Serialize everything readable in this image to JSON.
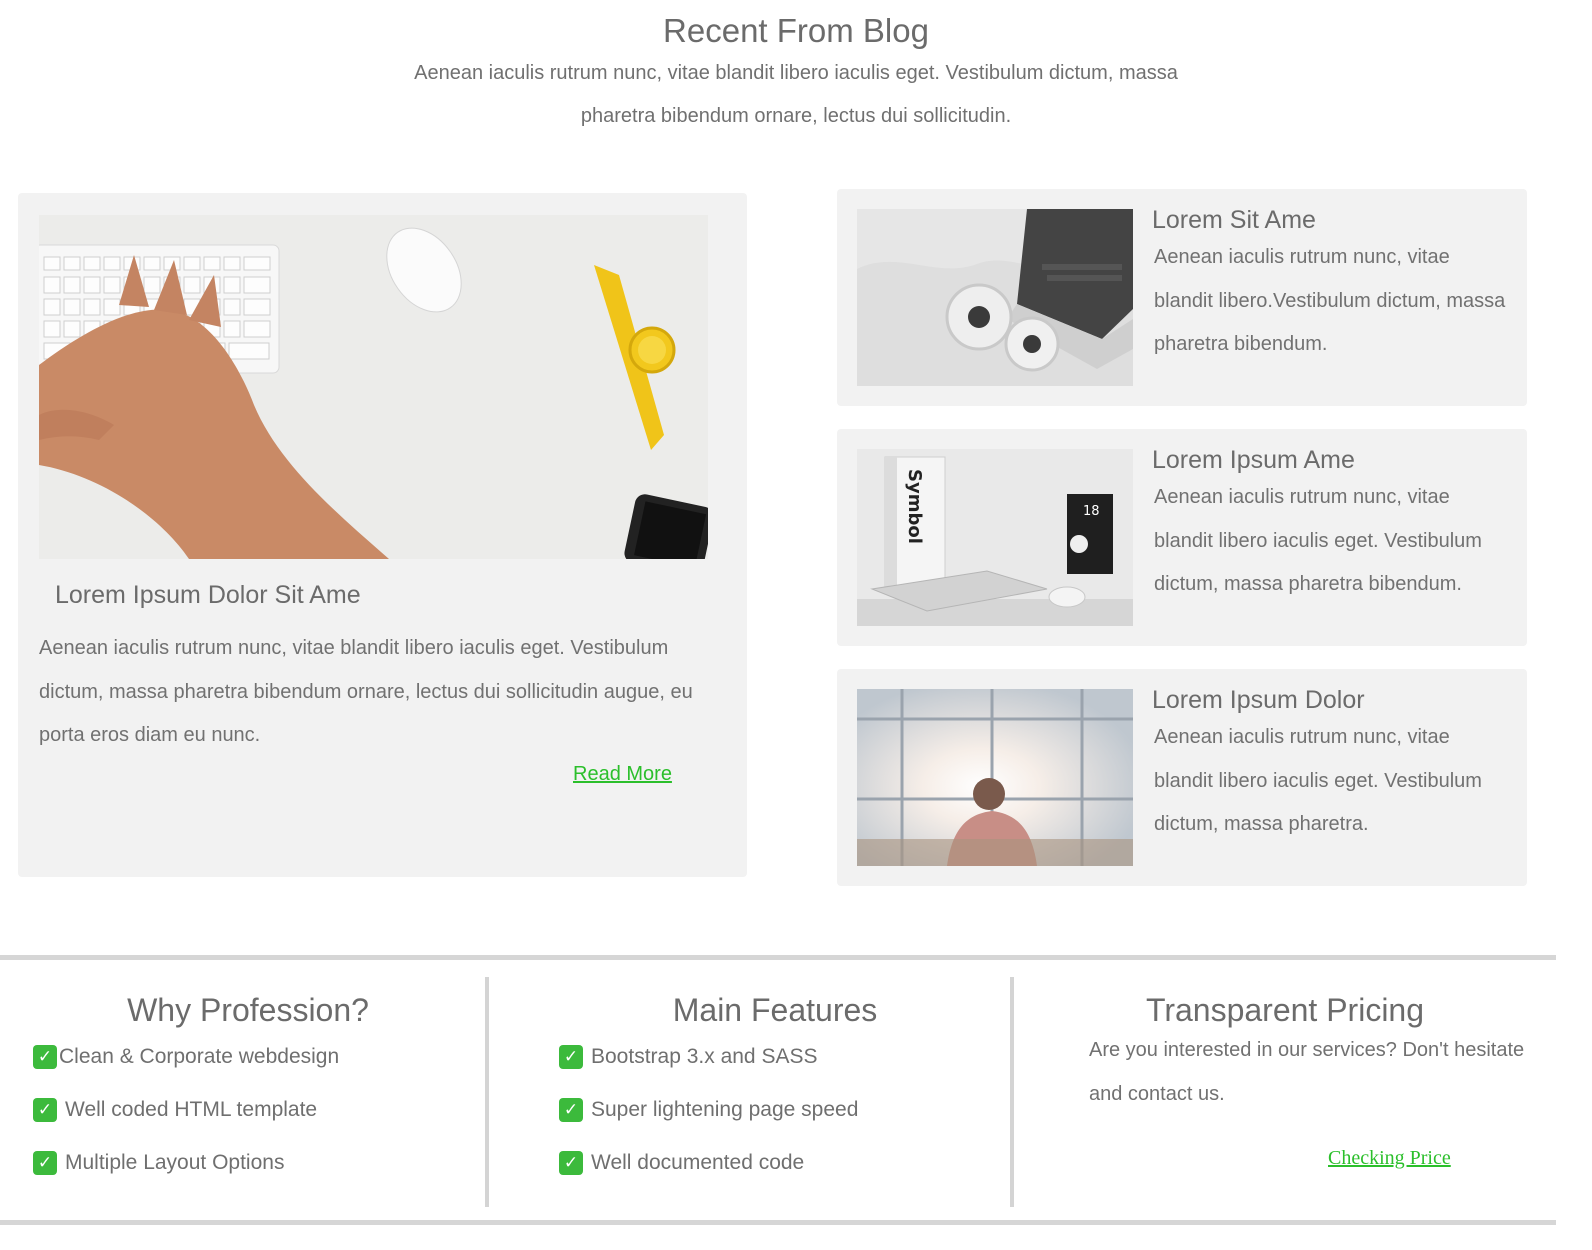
{
  "header": {
    "title": "Recent From Blog",
    "subtitle": "Aenean iaculis rutrum nunc, vitae blandit libero iaculis eget. Vestibulum dictum, massa pharetra bibendum ornare, lectus dui sollicitudin."
  },
  "featured": {
    "title": "Lorem Ipsum Dolor Sit Ame",
    "body": "Aenean iaculis rutrum nunc, vitae blandit libero iaculis eget. Vestibulum dictum, massa pharetra bibendum ornare, lectus dui sollicitudin augue, eu porta eros diam eu nunc.",
    "read_more": "Read More"
  },
  "side_posts": [
    {
      "title": "Lorem Sit Ame",
      "body": "Aenean iaculis rutrum nunc, vitae blandit libero.Vestibulum dictum, massa pharetra bibendum."
    },
    {
      "title": "Lorem Ipsum Ame",
      "body": "Aenean iaculis rutrum nunc, vitae blandit libero iaculis eget. Vestibulum dictum, massa pharetra bibendum."
    },
    {
      "title": "Lorem Ipsum Dolor",
      "body": "Aenean iaculis rutrum nunc, vitae blandit libero iaculis eget. Vestibulum dictum, massa pharetra."
    }
  ],
  "footer": {
    "why": {
      "title": "Why Profession?",
      "items": [
        "Clean & Corporate webdesign",
        "Well coded HTML template",
        "Multiple Layout Options"
      ]
    },
    "features": {
      "title": "Main Features",
      "items": [
        "Bootstrap 3.x and SASS",
        "Super lightening page speed",
        "Well documented code"
      ]
    },
    "pricing": {
      "title": "Transparent Pricing",
      "text": "Are you interested in our services? Don't hesitate and contact us.",
      "link": "Checking Price"
    }
  },
  "colors": {
    "accent_link": "#2bbf2b",
    "check_badge": "#3cba3c",
    "card_bg": "#f2f2f2"
  },
  "icons": {
    "check": "check-mark-icon"
  }
}
